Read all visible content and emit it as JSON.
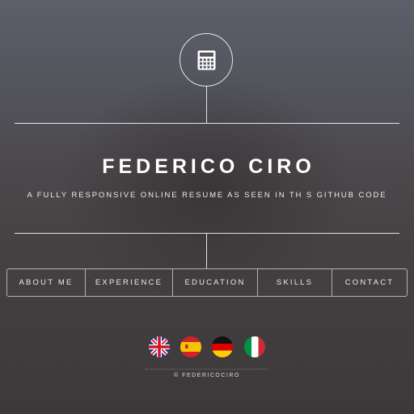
{
  "header": {
    "logo_icon": "calculator-icon",
    "name": "FEDERICO CIRO",
    "tagline": "A FULLY RESPONSIVE ONLINE RESUME AS SEEN IN TH S GITHUB CODE"
  },
  "nav": {
    "items": [
      {
        "label": "ABOUT ME"
      },
      {
        "label": "EXPERIENCE"
      },
      {
        "label": "EDUCATION"
      },
      {
        "label": "SKILLS"
      },
      {
        "label": "CONTACT"
      }
    ]
  },
  "languages": [
    {
      "icon": "uk-flag-icon"
    },
    {
      "icon": "spain-flag-icon"
    },
    {
      "icon": "germany-flag-icon"
    },
    {
      "icon": "italy-flag-icon"
    }
  ],
  "footer": {
    "copyright": "© FEDERICOCIRO"
  }
}
